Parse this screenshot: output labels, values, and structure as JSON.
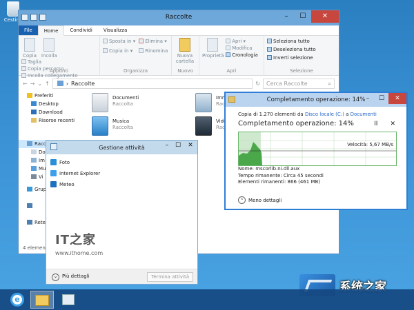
{
  "desktop": {
    "recycle_label": "Cestino"
  },
  "explorer": {
    "title": "Raccolte",
    "tabs": [
      "File",
      "Home",
      "Condividi",
      "Visualizza"
    ],
    "ribbon": {
      "appunti": {
        "copy": "Copia",
        "paste": "Incolla",
        "cut": "Taglia",
        "copy_path": "Copia percorso",
        "paste_link": "Incolla collegamento",
        "label": "Appunti"
      },
      "organizza": {
        "move": "Sposta in",
        "copy_to": "Copia in",
        "delete": "Elimina",
        "rename": "Rinomina",
        "label": "Organizza"
      },
      "nuovo": {
        "new_folder": "Nuova cartella",
        "label": "Nuovo"
      },
      "apri": {
        "props": "Proprietà",
        "open": "Apri",
        "edit": "Modifica",
        "history": "Cronologia",
        "label": "Apri"
      },
      "selezione": {
        "select_all": "Seleziona tutto",
        "deselect_all": "Deseleziona tutto",
        "invert": "Inverti selezione",
        "label": "Selezione"
      }
    },
    "address": {
      "path": "Raccolte",
      "search_placeholder": "Cerca Raccolte"
    },
    "nav": {
      "favorites": "Preferiti",
      "desktop": "Desktop",
      "download": "Download",
      "recent": "Risorse recenti",
      "libraries": "Raccolte",
      "lib_items": [
        "Do",
        "Im",
        "Mu",
        "Vi"
      ],
      "group": "Grup",
      "computer": "",
      "network": "Rete"
    },
    "libraries": [
      {
        "name": "Documenti",
        "sub": "Raccolta"
      },
      {
        "name": "Musica",
        "sub": "Raccolta"
      },
      {
        "name": "Imm",
        "sub": "Racc"
      },
      {
        "name": "Vide",
        "sub": "Racc"
      }
    ],
    "status": "4 elemen"
  },
  "taskmgr": {
    "title": "Gestione attività",
    "apps": [
      "Foto",
      "Internet Explorer",
      "Meteo"
    ],
    "more": "Più dettagli",
    "end_task": "Termina attività"
  },
  "watermark": {
    "logo": "IT之家",
    "url": "www.ithome.com"
  },
  "copy_dialog": {
    "title": "Completamento operazione: 14%",
    "line_prefix": "Copia di 1.270 elementi da ",
    "source": "Disco locale (C:)",
    "line_mid": " a ",
    "dest": "Documenti",
    "heading": "Completamento operazione: 14%",
    "pause": "II",
    "cancel": "✕",
    "speed": "Velocità: 5,67 MB/s",
    "name": "Nome:  mscorlib.ni.dll.aux",
    "time_left": "Tempo rimanente:  Circa 45 secondi",
    "items_left": "Elementi rimanenti:  866 (461 MB)",
    "less": "Meno dettagli",
    "progress": 0.14
  },
  "brand": {
    "text": "系统之家"
  },
  "colors": {
    "accent": "#1a61b0",
    "titlebar": "#6ea8da",
    "graph_fill": "#4aa84a",
    "close": "#c7463e"
  }
}
